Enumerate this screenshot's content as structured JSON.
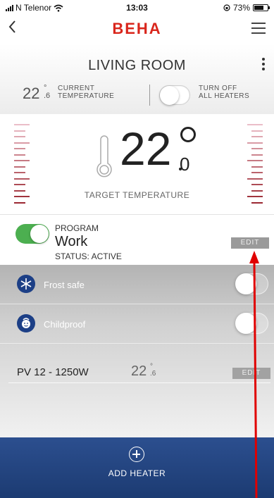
{
  "status_bar": {
    "carrier": "N Telenor",
    "time": "13:03",
    "battery": "73%",
    "battery_level": 0.73
  },
  "nav": {
    "logo": "BEHA",
    "back_icon": "chevron-left-icon",
    "menu_icon": "hamburger-icon"
  },
  "room": {
    "title": "LIVING ROOM",
    "current_temp_whole": "22",
    "current_temp_frac": ".6",
    "current_label_line1": "CURRENT",
    "current_label_line2": "TEMPERATURE",
    "heaters_label_line1": "TURN OFF",
    "heaters_label_line2": "ALL HEATERS",
    "heaters_toggle_on": false
  },
  "target": {
    "whole": "22",
    "frac": "0",
    "label": "TARGET TEMPERATURE"
  },
  "program": {
    "label": "PROGRAM",
    "name": "Work",
    "status": "STATUS: ACTIVE",
    "edit_label": "EDIT",
    "enabled": true
  },
  "settings": {
    "frost_label": "Frost safe",
    "frost_icon": "snowflake-icon",
    "child_label": "Childproof",
    "child_icon": "child-face-icon"
  },
  "heater": {
    "name": "PV 12 - 1250W",
    "temp_whole": "22",
    "temp_frac": ".6",
    "edit_label": "EDIT"
  },
  "footer": {
    "add_label": "ADD HEATER",
    "add_icon": "plus-circle-icon"
  },
  "colors": {
    "accent": "#d9261c",
    "program_on": "#4caf50",
    "footer_blue": "#254888",
    "annotation_red": "#e00000"
  }
}
